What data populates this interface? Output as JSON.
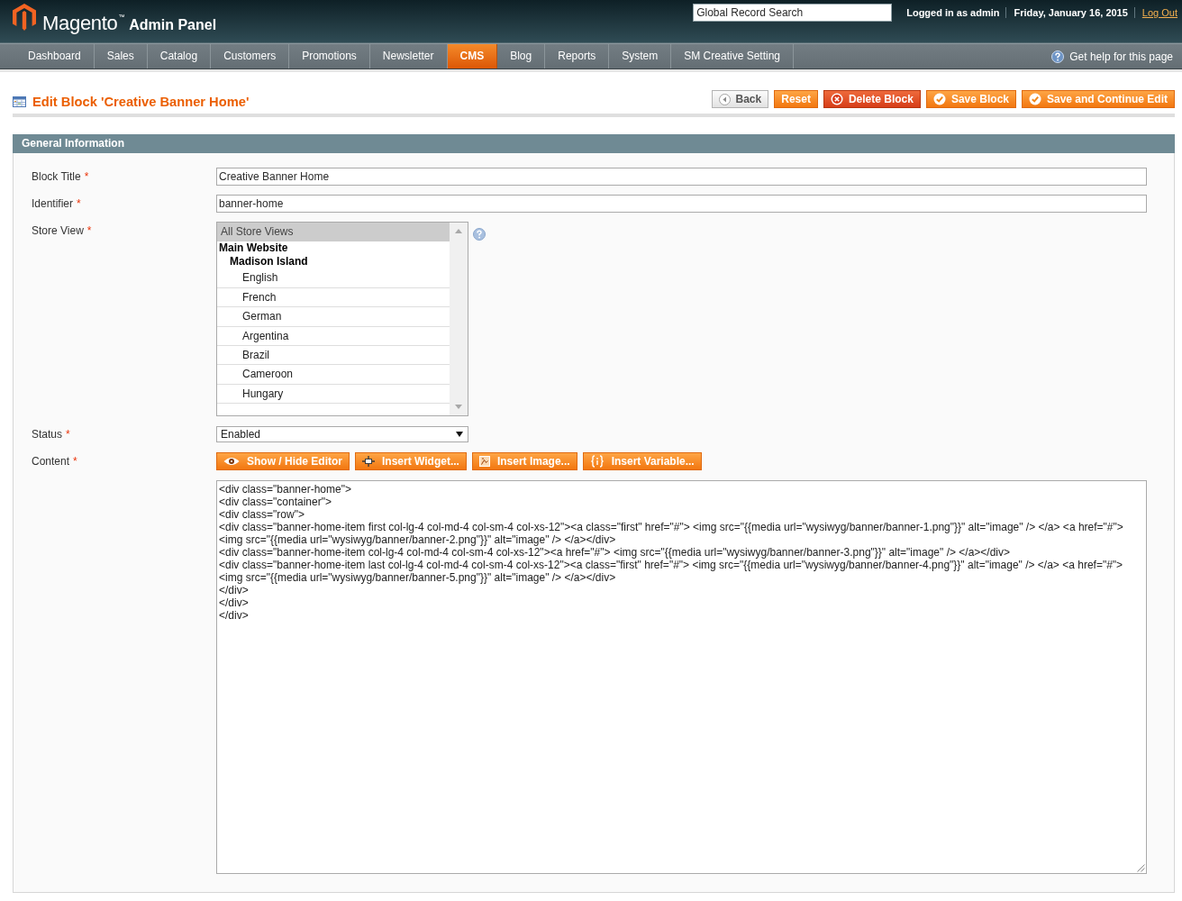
{
  "header": {
    "logo": {
      "brand": "Magento$^{™}$",
      "product": "Admin Panel"
    },
    "search": {
      "value": "Global Record Search"
    },
    "user": "Logged in as admin",
    "date": "Friday, January 16, 2015",
    "logout": "Log Out"
  },
  "nav": {
    "items": [
      {
        "label": "Dashboard",
        "selected": false
      },
      {
        "label": "Sales",
        "selected": false
      },
      {
        "label": "Catalog",
        "selected": false
      },
      {
        "label": "Customers",
        "selected": false
      },
      {
        "label": "Promotions",
        "selected": false
      },
      {
        "label": "Newsletter",
        "selected": false
      },
      {
        "label": "CMS",
        "selected": true
      },
      {
        "label": "Blog",
        "selected": false
      },
      {
        "label": "Reports",
        "selected": false
      },
      {
        "label": "System",
        "selected": false
      },
      {
        "label": "SM Creative Setting",
        "selected": false
      }
    ],
    "help": "Get help for this page"
  },
  "page": {
    "title": "Edit Block 'Creative Banner Home'",
    "buttons": [
      {
        "label": "Back",
        "kind": "back"
      },
      {
        "label": "Reset",
        "kind": "reset"
      },
      {
        "label": "Delete Block",
        "kind": "delete"
      },
      {
        "label": "Save Block",
        "kind": "save"
      },
      {
        "label": "Save and Continue Edit",
        "kind": "save"
      }
    ]
  },
  "section": {
    "title": "General Information",
    "fields": [
      {
        "kind": "text",
        "label": "Block Title",
        "required_mark": "*",
        "value": "Creative Banner Home"
      },
      {
        "kind": "text",
        "label": "Identifier",
        "required_mark": "*",
        "value": "banner-home"
      },
      {
        "kind": "multiselect",
        "label": "Store View",
        "required_mark": "*",
        "help": true,
        "options": [
          {
            "kind": "option",
            "label": "All Store Views",
            "selected": true
          },
          {
            "kind": "group",
            "label": "Main Website",
            "children": [
              {
                "kind": "group",
                "label": "Madison Island",
                "children": [
                  {
                    "kind": "option",
                    "label": "English",
                    "selected": false
                  },
                  {
                    "kind": "option",
                    "label": "French",
                    "selected": false
                  },
                  {
                    "kind": "option",
                    "label": "German",
                    "selected": false
                  },
                  {
                    "kind": "option",
                    "label": "Argentina",
                    "selected": false
                  },
                  {
                    "kind": "option",
                    "label": "Brazil",
                    "selected": false
                  },
                  {
                    "kind": "option",
                    "label": "Cameroon",
                    "selected": false
                  },
                  {
                    "kind": "option",
                    "label": "Hungary",
                    "selected": false
                  }
                ]
              }
            ]
          }
        ]
      },
      {
        "kind": "select",
        "label": "Status",
        "required_mark": "*",
        "value": "Enabled"
      },
      {
        "kind": "editor",
        "label": "Content",
        "required_mark": "*",
        "buttons": [
          {
            "label": "Show / Hide Editor",
            "kind": "toggle"
          },
          {
            "label": "Insert Widget...",
            "kind": "widget"
          },
          {
            "label": "Insert Image...",
            "kind": "image"
          },
          {
            "label": "Insert Variable...",
            "kind": "variable"
          }
        ],
        "lines": [
          "<div class=\"banner-home\">",
          "<div class=\"container\">",
          "<div class=\"row\">",
          "<div class=\"banner-home-item first col-lg-4 col-md-4 col-sm-4 col-xs-12\"><a class=\"first\" href=\"#\"> <img src=\"{{media url=\"wysiwyg/banner/banner-1.png\"}}\" alt=\"image\" /> </a> <a href=\"#\">",
          "<img src=\"{{media url=\"wysiwyg/banner/banner-2.png\"}}\" alt=\"image\" /> </a></div>",
          "<div class=\"banner-home-item col-lg-4 col-md-4 col-sm-4 col-xs-12\"><a href=\"#\"> <img src=\"{{media url=\"wysiwyg/banner/banner-3.png\"}}\" alt=\"image\" /> </a></div>",
          "<div class=\"banner-home-item last col-lg-4 col-md-4 col-sm-4 col-xs-12\"><a class=\"first\" href=\"#\"> <img src=\"{{media url=\"wysiwyg/banner/banner-4.png\"}}\" alt=\"image\" /> </a> <a href=\"#\">",
          "<img src=\"{{media url=\"wysiwyg/banner/banner-5.png\"}}\" alt=\"image\" /> </a></div>",
          "</div>",
          "</div>",
          "</div>"
        ]
      }
    ]
  }
}
